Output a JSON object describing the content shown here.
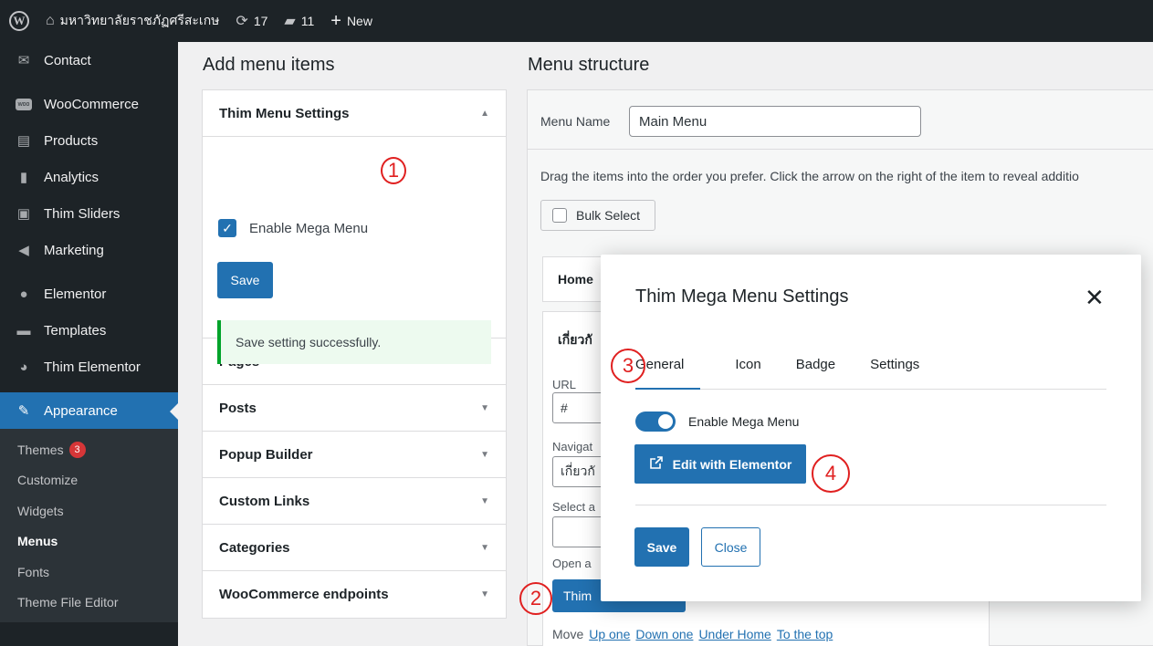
{
  "adminbar": {
    "site_name": "มหาวิทยาลัยราชภัฏศรีสะเกษ",
    "updates_count": "17",
    "comments_count": "11",
    "new_label": "New"
  },
  "sidebar": {
    "items_top": [
      {
        "label": "Contact",
        "icon": "mail-icon"
      },
      {
        "label": "WooCommerce",
        "icon": "woo-icon"
      },
      {
        "label": "Products",
        "icon": "archive-icon"
      },
      {
        "label": "Analytics",
        "icon": "bar-chart-icon"
      },
      {
        "label": "Thim Sliders",
        "icon": "slides-icon"
      },
      {
        "label": "Marketing",
        "icon": "megaphone-icon"
      },
      {
        "label": "Elementor",
        "icon": "elementor-icon"
      },
      {
        "label": "Templates",
        "icon": "folder-icon"
      },
      {
        "label": "Thim Elementor",
        "icon": "thim-icon"
      },
      {
        "label": "Appearance",
        "icon": "paintbrush-icon"
      }
    ],
    "submenu": [
      {
        "label": "Themes",
        "badge": "3"
      },
      {
        "label": "Customize"
      },
      {
        "label": "Widgets"
      },
      {
        "label": "Menus"
      },
      {
        "label": "Fonts"
      },
      {
        "label": "Theme File Editor"
      }
    ]
  },
  "add_items": {
    "title": "Add menu items",
    "thim_settings": {
      "heading": "Thim Menu Settings",
      "checkbox_label": "Enable Mega Menu",
      "save_label": "Save",
      "notice": "Save setting successfully."
    },
    "sections": [
      "Pages",
      "Posts",
      "Popup Builder",
      "Custom Links",
      "Categories",
      "WooCommerce endpoints"
    ]
  },
  "structure": {
    "title": "Menu structure",
    "menu_name_label": "Menu Name",
    "menu_name_value": "Main Menu",
    "drag_hint": "Drag the items into the order you prefer. Click the arrow on the right of the item to reveal additio",
    "bulk_select": "Bulk Select",
    "item_home": "Home",
    "item_about": "เกี่ยวกั",
    "url_label": "URL",
    "url_value": "#",
    "nav_label": "Navigat",
    "nav_value": "เกี่ยวกั",
    "select_label": "Select a",
    "open_label": "Open a",
    "thim_button": "Thim",
    "move_label": "Move",
    "move_links": [
      "Up one",
      "Down one",
      "Under Home",
      "To the top"
    ]
  },
  "modal": {
    "title": "Thim Mega Menu Settings",
    "close_glyph": "✕",
    "tabs": [
      "General",
      "Icon",
      "Badge",
      "Settings"
    ],
    "toggle_label": "Enable Mega Menu",
    "edit_button": "Edit with Elementor",
    "save_label": "Save",
    "cancel_label": "Close"
  },
  "annotations": [
    "1",
    "2",
    "3",
    "4"
  ]
}
